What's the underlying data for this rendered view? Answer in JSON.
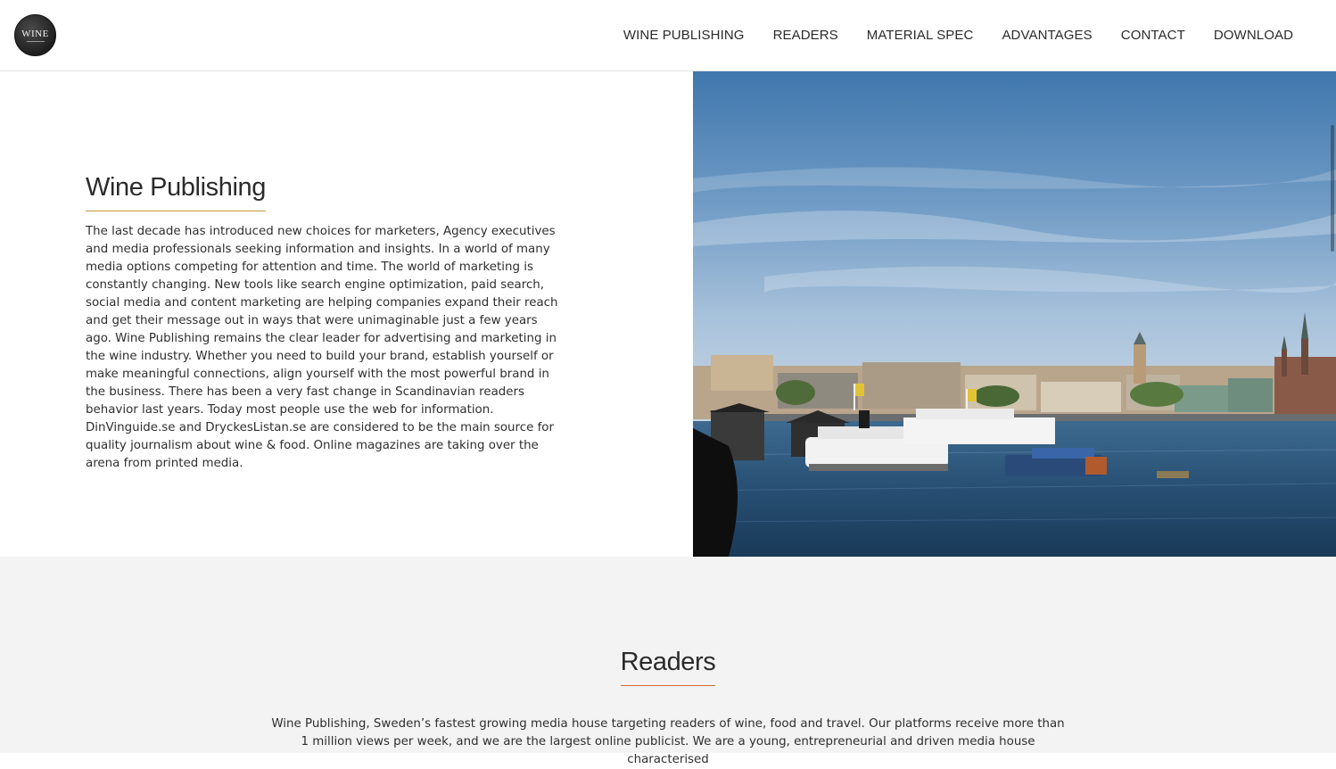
{
  "header": {
    "logo_text": "WINE",
    "nav": [
      {
        "label": "WINE PUBLISHING"
      },
      {
        "label": "READERS"
      },
      {
        "label": "MATERIAL SPEC"
      },
      {
        "label": "ADVANTAGES"
      },
      {
        "label": "CONTACT"
      },
      {
        "label": "DOWNLOAD"
      }
    ]
  },
  "intro": {
    "title": "Wine Publishing",
    "body": "The last decade has introduced new choices for marketers, Agency executives and media professionals seeking information and insights. In a world of many media options competing for attention and time. The world of marketing is constantly changing. New tools like search engine optimization, paid search, social media and content marketing are helping companies expand their reach and get their message out in ways that were unimaginable just a few years ago. Wine Publishing remains the clear leader for advertising and marketing in the wine industry. Whether you need to build your brand, establish yourself or make meaningful connections, align yourself with the most powerful brand in the business. There has been a very fast change in Scandinavian readers behavior last years. Today most people use the web for information. DinVinguide.se and DryckesListan.se are considered to be the main source for quality journalism about wine & food. Online magazines are taking over the arena from printed media."
  },
  "readers": {
    "title": "Readers",
    "body": "Wine Publishing, Sweden’s fastest growing media house targeting readers of wine, food and travel. Our platforms receive more than 1 million views per week, and we are the largest online publicist. We are a young, entrepreneurial and driven media house characterised"
  },
  "colors": {
    "intro_underline": "#c79a3e",
    "readers_underline": "#d66d2e",
    "readers_bg": "#f3f3f3"
  }
}
